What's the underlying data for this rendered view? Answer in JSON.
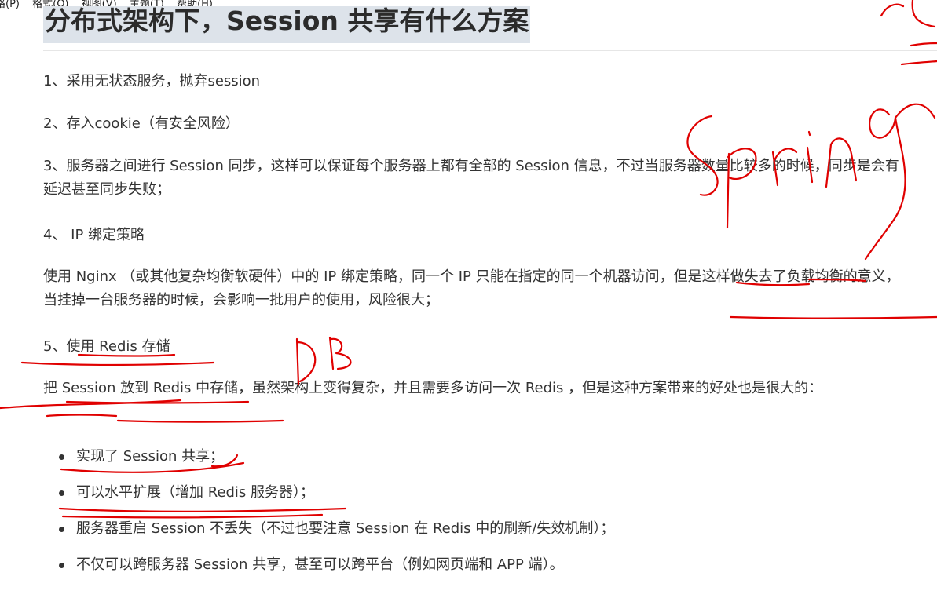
{
  "menu": [
    "格(P)",
    "格式(O)",
    "视图(V)",
    "主题(T)",
    "帮助(H)"
  ],
  "title": "分布式架构下，Session 共享有什么方案",
  "items": {
    "i1": "1、采用无状态服务，抛弃session",
    "i2": "2、存入cookie（有安全风险）",
    "i3": "3、服务器之间进行 Session 同步，这样可以保证每个服务器上都有全部的 Session 信息，不过当服务器数量比较多的时候，同步是会有延迟甚至同步失败；",
    "i4": "4、 IP 绑定策略",
    "i4_desc": "使用 Nginx （或其他复杂均衡软硬件）中的 IP 绑定策略，同一个 IP 只能在指定的同一个机器访问，但是这样做失去了负载均衡的意义，当挂掉一台服务器的时候，会影响一批用户的使用，风险很大；",
    "i5": "5、使用 Redis 存储",
    "i5_desc": "把 Session 放到 Redis 中存储，虽然架构上变得复杂，并且需要多访问一次 Redis ，但是这种方案带来的好处也是很大的："
  },
  "bullets": [
    "实现了 Session 共享；",
    "可以水平扩展（增加 Redis 服务器）；",
    "服务器重启 Session 不丢失（不过也要注意 Session 在 Redis 中的刷新/失效机制）；",
    "不仅可以跨服务器 Session 共享，甚至可以跨平台（例如网页端和 APP 端）。"
  ],
  "annotation_color": "#e00000"
}
